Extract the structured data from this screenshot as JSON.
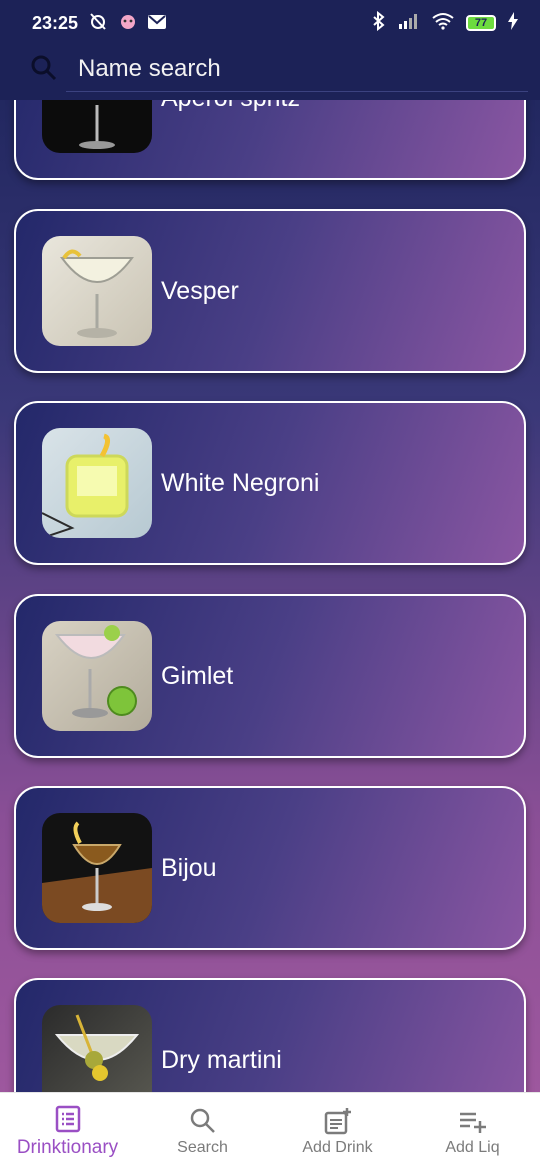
{
  "status_bar": {
    "time": "23:25",
    "battery": "77"
  },
  "search": {
    "placeholder": "Name search"
  },
  "drinks": [
    {
      "name": "Aperol spritz",
      "thumb": "aperol-spritz-photo"
    },
    {
      "name": "Vesper",
      "thumb": "vesper-photo"
    },
    {
      "name": "White Negroni",
      "thumb": "white-negroni-photo"
    },
    {
      "name": "Gimlet",
      "thumb": "gimlet-photo"
    },
    {
      "name": "Bijou",
      "thumb": "bijou-photo"
    },
    {
      "name": "Dry martini",
      "thumb": "dry-martini-photo"
    }
  ],
  "bottom_nav": [
    {
      "label": "Drinktionary",
      "icon": "list-document-icon",
      "active": true
    },
    {
      "label": "Search",
      "icon": "search-icon",
      "active": false
    },
    {
      "label": "Add Drink",
      "icon": "add-note-icon",
      "active": false
    },
    {
      "label": "Add Liq",
      "icon": "playlist-add-icon",
      "active": false
    }
  ],
  "colors": {
    "header_bg": "#1c2257",
    "nav_active": "#9a4fc4",
    "nav_inactive": "#7b7b7b"
  }
}
